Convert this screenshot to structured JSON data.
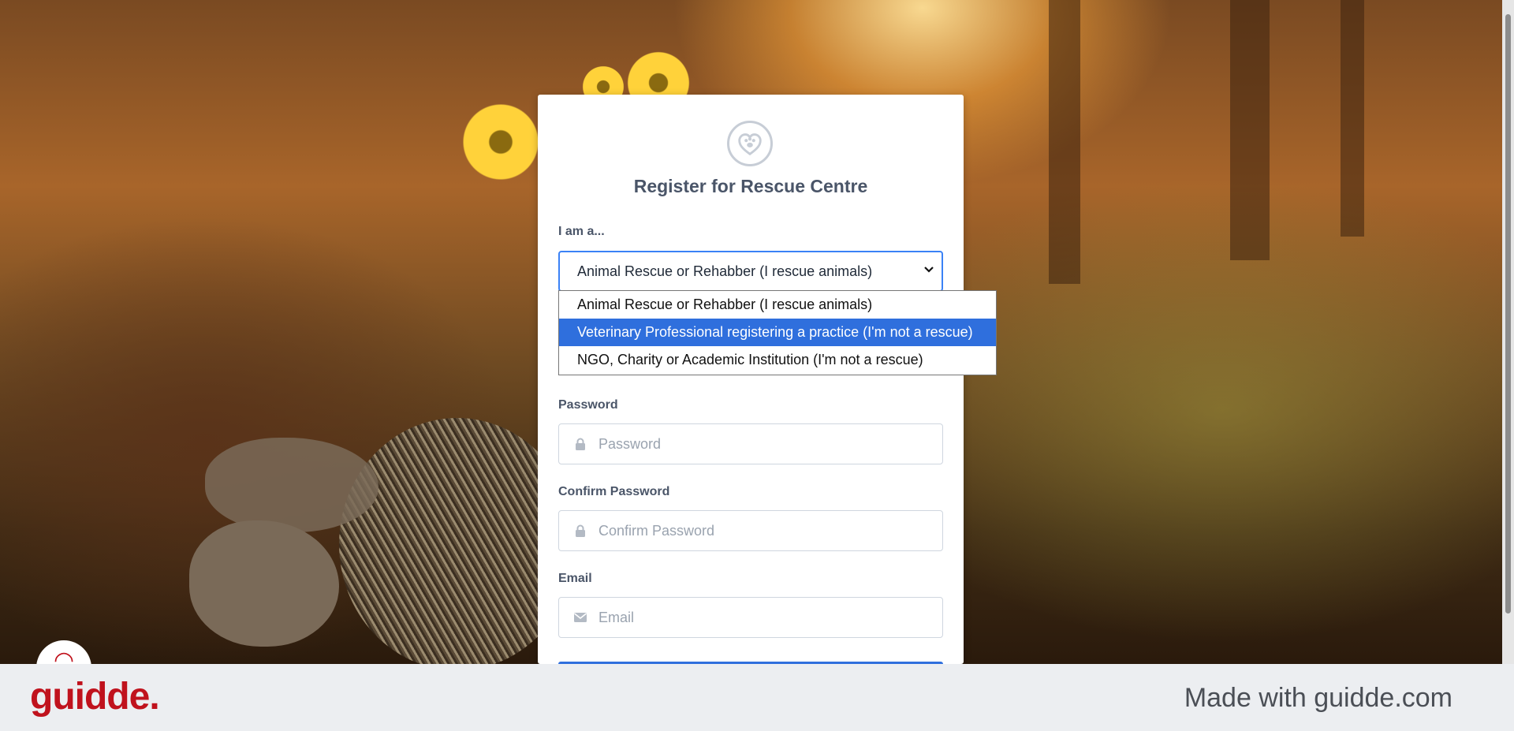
{
  "form": {
    "title": "Register for Rescue Centre",
    "role_label": "I am a...",
    "role_selected": "Animal Rescue or Rehabber (I rescue animals)",
    "role_options": [
      "Animal Rescue or Rehabber (I rescue animals)",
      "Veterinary Professional registering a practice (I'm not a rescue)",
      "NGO, Charity or Academic Institution (I'm not a rescue)"
    ],
    "role_highlighted_index": 1,
    "password_label": "Password",
    "password_placeholder": "Password",
    "confirm_label": "Confirm Password",
    "confirm_placeholder": "Confirm Password",
    "email_label": "Email",
    "email_placeholder": "Email"
  },
  "footer": {
    "brand": "guidde.",
    "made_with": "Made with guidde.com"
  },
  "colors": {
    "accent": "#2f6fdd",
    "brand": "#c0121d",
    "label_text": "#4a5568"
  },
  "icons": {
    "logo": "paw-heart-icon",
    "password": "lock-icon",
    "confirm": "lock-icon",
    "email": "envelope-icon",
    "select": "chevron-down-icon"
  }
}
